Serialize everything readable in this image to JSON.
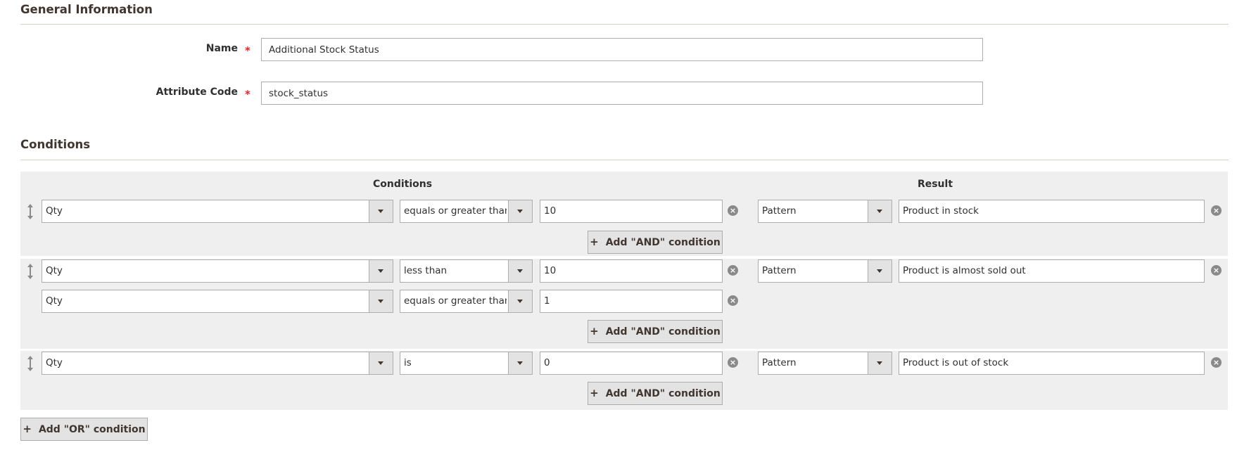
{
  "general": {
    "title": "General Information",
    "name_label": "Name",
    "name_value": "Additional Stock Status",
    "code_label": "Attribute Code",
    "code_value": "stock_status",
    "required_mark": "*"
  },
  "conditions": {
    "title": "Conditions",
    "col_conditions": "Conditions",
    "col_result": "Result",
    "add_and_label": "Add \"AND\" condition",
    "add_or_label": "Add \"OR\" condition",
    "rules": [
      {
        "conditions": [
          {
            "attribute": "Qty",
            "operator": "equals or greater than",
            "value": "10"
          }
        ],
        "result_type": "Pattern",
        "result_value": "Product in stock"
      },
      {
        "conditions": [
          {
            "attribute": "Qty",
            "operator": "less than",
            "value": "10"
          },
          {
            "attribute": "Qty",
            "operator": "equals or greater than",
            "value": "1"
          }
        ],
        "result_type": "Pattern",
        "result_value": "Product is almost sold out"
      },
      {
        "conditions": [
          {
            "attribute": "Qty",
            "operator": "is",
            "value": "0"
          }
        ],
        "result_type": "Pattern",
        "result_value": "Product is out of stock"
      }
    ]
  },
  "icons": {
    "remove": "×",
    "plus": "+",
    "drag": "drag-handle-icon",
    "chevron": "chevron-down-icon"
  }
}
